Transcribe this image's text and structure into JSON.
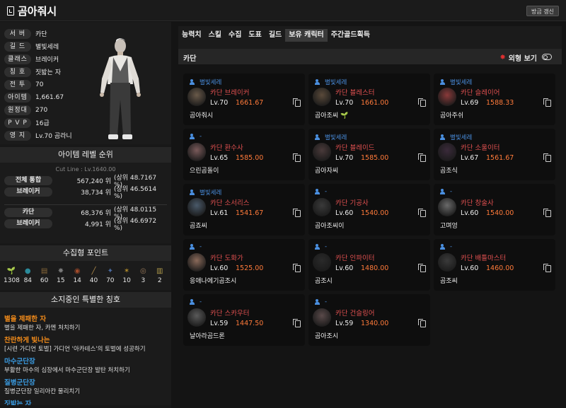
{
  "header": {
    "title": "곰아줘시",
    "refresh_label": "방금 갱신"
  },
  "profile": {
    "rows": [
      {
        "label": "서 버",
        "value": "카단"
      },
      {
        "label": "길 드",
        "value": "별빛세레"
      },
      {
        "label": "클래스",
        "value": "브레이커"
      },
      {
        "label": "칭 호",
        "value": "짓밟는 자"
      },
      {
        "label": "전 투",
        "value": "70"
      },
      {
        "label": "아이템",
        "value": "1,661.67"
      },
      {
        "label": "원정대",
        "value": "270"
      },
      {
        "label": "P V P",
        "value": "16급"
      },
      {
        "label": "영 지",
        "value": "Lv.70 곰라니"
      }
    ]
  },
  "ranking": {
    "title": "아이템 레벨 순위",
    "cutline": "Cut Line : Lv.1640.00",
    "rows": [
      {
        "label": "전체 통합",
        "rank": "567,240 위",
        "percent": "(상위 48.7167 %)"
      },
      {
        "label": "브레이커",
        "rank": "38,734 위",
        "percent": "(상위 46.5614 %)"
      },
      {
        "label": "카단",
        "rank": "68,376 위",
        "percent": "(상위 48.0115 %)"
      },
      {
        "label": "브레이커",
        "rank": "4,991 위",
        "percent": "(상위 46.6972 %)"
      }
    ]
  },
  "collect": {
    "title": "수집형 포인트",
    "items": [
      {
        "icon": "mokoko-seed-icon",
        "glyph": "🌱",
        "color": "#6a8a2a",
        "value": "1308"
      },
      {
        "icon": "island-heart-icon",
        "glyph": "●",
        "color": "#2a8a9a",
        "value": "84"
      },
      {
        "icon": "masterpiece-icon",
        "glyph": "▤",
        "color": "#8a6a3a",
        "value": "60"
      },
      {
        "icon": "giant-heart-icon",
        "glyph": "✸",
        "color": "#7a7a7a",
        "value": "15"
      },
      {
        "icon": "ignea-token-icon",
        "glyph": "◉",
        "color": "#a04a2a",
        "value": "14"
      },
      {
        "icon": "adventure-tome-icon",
        "glyph": "╱",
        "color": "#b08a4a",
        "value": "40"
      },
      {
        "icon": "sea-bounty-icon",
        "glyph": "✦",
        "color": "#4a6aa0",
        "value": "70"
      },
      {
        "icon": "world-tree-leaf-icon",
        "glyph": "✶",
        "color": "#b08a2a",
        "value": "10"
      },
      {
        "icon": "omnium-star-icon",
        "glyph": "◎",
        "color": "#9a7a5a",
        "value": "3"
      },
      {
        "icon": "orpheus-star-icon",
        "glyph": "▥",
        "color": "#b09a4a",
        "value": "2"
      }
    ]
  },
  "titles_section": {
    "title": "소지중인 특별한 칭호",
    "items": [
      {
        "name": "별을 제패한 자",
        "color": "#f08a1a",
        "desc": "별을 제패한 자, 카멘 처치하기"
      },
      {
        "name": "찬란하게 빛나는",
        "color": "#f08a1a",
        "desc": "[시련 가디언 토벌] 가디언 '아카테스'의 토벌에 성공하기"
      },
      {
        "name": "마수군단장",
        "color": "#3a9ae0",
        "desc": "부활한 마수의 심장에서 마수군단장 발탄 처치하기"
      },
      {
        "name": "질병군단장",
        "color": "#3a9ae0",
        "desc": "질병군단장 일리아칸 물리치기"
      },
      {
        "name": "짓밟는 자",
        "color": "#3a9ae0",
        "desc": ""
      }
    ]
  },
  "tabs": [
    "능력치",
    "스킬",
    "수집",
    "도표",
    "길드",
    "보유 캐릭터",
    "주간골드획득"
  ],
  "active_tab": 5,
  "panel": {
    "server": "카단",
    "look_label": "외형 보기"
  },
  "characters": [
    {
      "guild": "별빛세레",
      "server": "카단",
      "class": "브레이커",
      "level": "Lv.70",
      "item_level": "1661.67",
      "name": "곰아줘시",
      "has_seed": false,
      "portrait": "#6a5a4a"
    },
    {
      "guild": "별빛세레",
      "server": "카단",
      "class": "블레스터",
      "level": "Lv.70",
      "item_level": "1661.00",
      "name": "곰아조씨",
      "has_seed": true,
      "portrait": "#5a4a3a"
    },
    {
      "guild": "별빛세레",
      "server": "카단",
      "class": "슬레이어",
      "level": "Lv.69",
      "item_level": "1588.33",
      "name": "곰아주쉬",
      "has_seed": false,
      "portrait": "#8a3a3a"
    },
    {
      "guild": "-",
      "server": "카단",
      "class": "환수사",
      "level": "Lv.65",
      "item_level": "1585.00",
      "name": "으린곰돌이",
      "has_seed": false,
      "portrait": "#7a5a5a"
    },
    {
      "guild": "별빛세레",
      "server": "카단",
      "class": "블레이드",
      "level": "Lv.70",
      "item_level": "1585.00",
      "name": "곰아자씨",
      "has_seed": false,
      "portrait": "#4a3a3a"
    },
    {
      "guild": "별빛세레",
      "server": "카단",
      "class": "소울이터",
      "level": "Lv.67",
      "item_level": "1561.67",
      "name": "곰조식",
      "has_seed": false,
      "portrait": "#3a2a3a"
    },
    {
      "guild": "별빛세레",
      "server": "카단",
      "class": "소서리스",
      "level": "Lv.61",
      "item_level": "1541.67",
      "name": "곰죠씨",
      "has_seed": false,
      "portrait": "#4a5a6a"
    },
    {
      "guild": "-",
      "server": "카단",
      "class": "기공사",
      "level": "Lv.60",
      "item_level": "1540.00",
      "name": "곰아조씨이",
      "has_seed": false,
      "portrait": "#3a3a3a"
    },
    {
      "guild": "-",
      "server": "카단",
      "class": "창술사",
      "level": "Lv.60",
      "item_level": "1540.00",
      "name": "고며엉",
      "has_seed": false,
      "portrait": "#6a6a6a"
    },
    {
      "guild": "-",
      "server": "카단",
      "class": "도화가",
      "level": "Lv.60",
      "item_level": "1525.00",
      "name": "응애나에기곰조시",
      "has_seed": false,
      "portrait": "#8a6a5a"
    },
    {
      "guild": "-",
      "server": "카단",
      "class": "인파이터",
      "level": "Lv.60",
      "item_level": "1480.00",
      "name": "곰조시",
      "has_seed": false,
      "portrait": "#2a2a2a"
    },
    {
      "guild": "-",
      "server": "카단",
      "class": "배틀마스터",
      "level": "Lv.60",
      "item_level": "1460.00",
      "name": "곰조씨",
      "has_seed": false,
      "portrait": "#3a3a3a"
    },
    {
      "guild": "-",
      "server": "카단",
      "class": "스카우터",
      "level": "Lv.59",
      "item_level": "1447.50",
      "name": "날아라곰드론",
      "has_seed": false,
      "portrait": "#5a5a5a"
    },
    {
      "guild": "-",
      "server": "카단",
      "class": "건슬링어",
      "level": "Lv.59",
      "item_level": "1340.00",
      "name": "곰아조시",
      "has_seed": false,
      "portrait": "#5a4a4a"
    }
  ]
}
